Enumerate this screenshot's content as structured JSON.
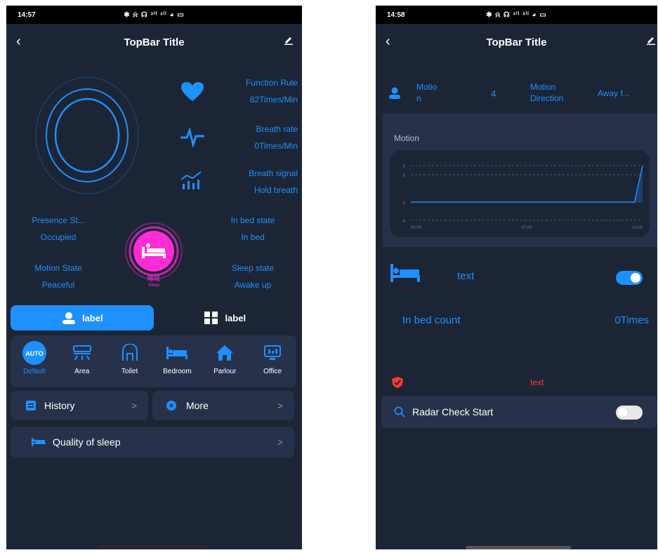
{
  "left": {
    "status": {
      "time": "14:57",
      "icons": "✱ ⍾ ☊ ᵌⁱˡ ᵌⁱˡ ◕ ▭"
    },
    "topbar": {
      "title": "TopBar Title"
    },
    "vitals": [
      {
        "icon": "heart-icon",
        "label": "Function Rule",
        "value": "82Times/Min"
      },
      {
        "icon": "pulse-icon",
        "label": "Breath rate",
        "value": "0Times/Min"
      },
      {
        "icon": "signal-chart-icon",
        "label": "Breath signal",
        "value": "Hold breath"
      }
    ],
    "states": {
      "presence_label": "Presence St...",
      "presence_value": "Occupied",
      "motion_label": "Motion State",
      "motion_value": "Peaceful",
      "inbed_label": "In bed state",
      "inbed_value": "In bed",
      "sleep_label": "Sleep state",
      "sleep_value": "Awake up",
      "center_caption": "睡眠",
      "center_sub": "Sleep"
    },
    "tabs": [
      {
        "label": "label",
        "icon": "user-icon"
      },
      {
        "label": "label",
        "icon": "grid-icon"
      }
    ],
    "scenes": [
      {
        "label": "Default",
        "icon": "auto-icon",
        "icon_text": "AUTO"
      },
      {
        "label": "Area",
        "icon": "air-conditioner-icon"
      },
      {
        "label": "Toilet",
        "icon": "toilet-icon"
      },
      {
        "label": "Bedroom",
        "icon": "bed-icon"
      },
      {
        "label": "Parlour",
        "icon": "home-icon"
      },
      {
        "label": "Office",
        "icon": "monitor-icon"
      }
    ],
    "history": "History",
    "more": "More",
    "quality": "Quality of sleep"
  },
  "right": {
    "status": {
      "time": "14:58",
      "icons": "✱ ⍾ ☊ ᵌⁱˡ ᵌⁱˡ ◕ ▭"
    },
    "topbar": {
      "title": "TopBar Title"
    },
    "info": {
      "motion_label": "Motio\nn",
      "motion_value": "4",
      "direction_label": "Motion Direction",
      "direction_value": "Away f..."
    },
    "chart_title": "Motion",
    "chart_data": {
      "type": "line",
      "x_ticks": [
        "00:00",
        "07:00",
        "14:00"
      ],
      "y_ticks": [
        "8",
        "6",
        "0",
        "-4"
      ],
      "series": [
        {
          "values": [
            0,
            0,
            0,
            0,
            0,
            0,
            0,
            0,
            0,
            0,
            0,
            0,
            0,
            0,
            0,
            0,
            0,
            0,
            0,
            0,
            0,
            0,
            0,
            0,
            0,
            0,
            0,
            0,
            0,
            8
          ]
        }
      ],
      "ylim": [
        -4,
        8
      ],
      "color": "#1e90ff"
    },
    "bed_text": "text",
    "inbed_count_label": "In bed count",
    "inbed_count_value": "0Times",
    "alert_text": "text",
    "radar_label": "Radar Check Start",
    "colors": {
      "accent": "#1e90ff",
      "alert": "#ff3b30",
      "magenta": "#ff2bd6"
    }
  }
}
